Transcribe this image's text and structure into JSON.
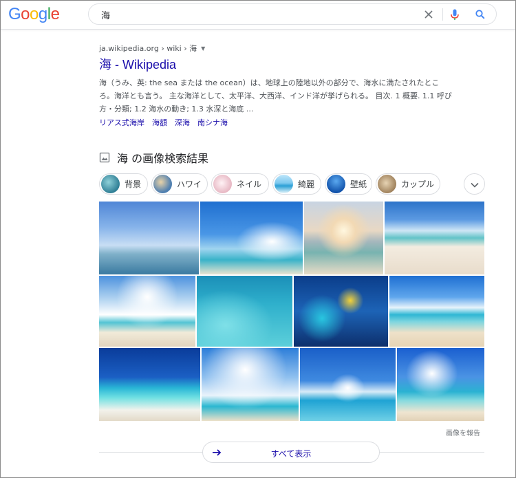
{
  "header": {
    "logo": [
      "G",
      "o",
      "o",
      "g",
      "l",
      "e"
    ],
    "logo_colors": [
      "#4285f4",
      "#ea4335",
      "#fbbc05",
      "#4285f4",
      "#34a853",
      "#ea4335"
    ],
    "query": "海"
  },
  "result": {
    "cite": "ja.wikipedia.org › wiki › 海",
    "title": "海 - Wikipedia",
    "snippet": "海（うみ、英: the sea または the ocean）は、地球上の陸地以外の部分で、海水に満たされたところ。海洋とも言う。 主な海洋として、太平洋、大西洋、インド洋が挙げられる。 目次. 1 概要. 1.1 呼び方・分類; 1.2 海水の動き; 1.3 水深と海底 ...",
    "sitelinks": [
      "リアス式海岸",
      "海額",
      "深海",
      "南シナ海"
    ]
  },
  "images": {
    "heading": "海 の画像検索結果",
    "chips": [
      {
        "label": "背景",
        "color": "#3f8fa6"
      },
      {
        "label": "ハワイ",
        "color": "#4f7fb0"
      },
      {
        "label": "ネイル",
        "color": "#e7b7c3"
      },
      {
        "label": "綺麗",
        "color": "#5fb5e0"
      },
      {
        "label": "壁紙",
        "color": "#1a63c4"
      },
      {
        "label": "カップル",
        "color": "#b79a72"
      }
    ],
    "report": "画像を報告",
    "show_all": "すべて表示"
  },
  "colors": {
    "link": "#1a0dab",
    "accent_blue": "#4285f4"
  }
}
